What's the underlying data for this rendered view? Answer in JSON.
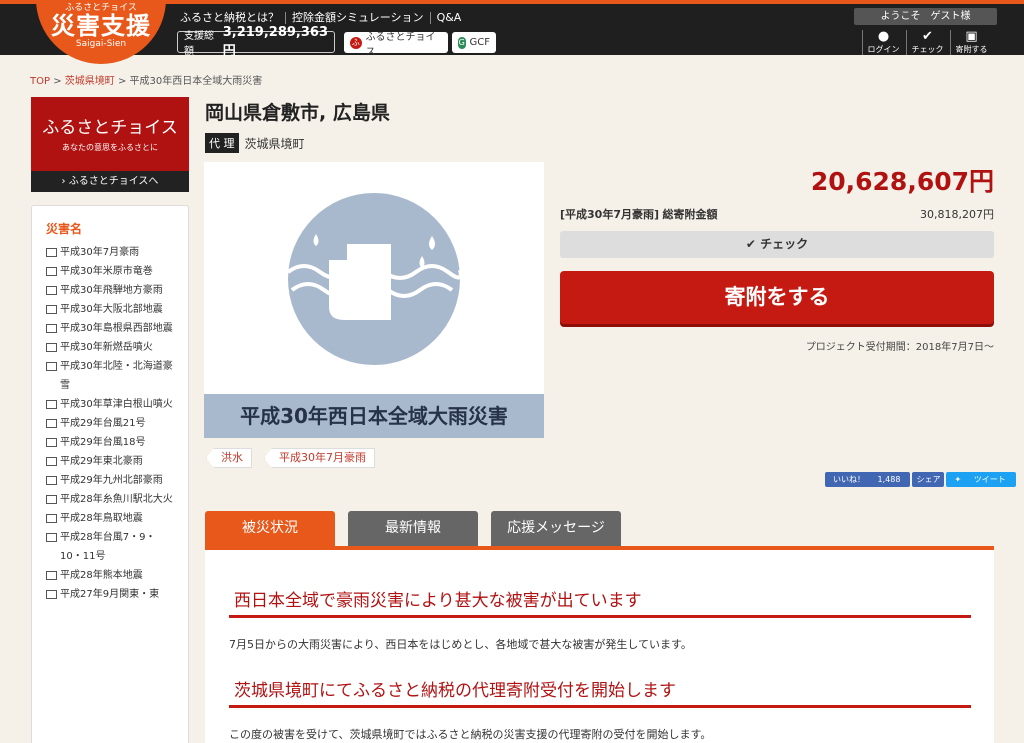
{
  "header": {
    "logo_small": "ふるさとチョイス",
    "logo_big": "災害支援",
    "logo_en": "Saigai-Sien",
    "nav": [
      "ふるさと納税とは？",
      "控除金額シミュレーション",
      "Q&A"
    ],
    "total_label": "支援総額",
    "total_value": "3,219,289,363 円",
    "chip_choice": "ふるさとチョイス",
    "chip_gcf": "GCF",
    "welcome": "ようこそ　ゲスト様",
    "icons": [
      {
        "name": "login",
        "label": "ログイン",
        "glyph": "●"
      },
      {
        "name": "check",
        "label": "チェック",
        "glyph": "✔"
      },
      {
        "name": "donate",
        "label": "寄附する",
        "glyph": "▣"
      }
    ]
  },
  "breadcrumb": {
    "top": "TOP",
    "town": "茨城県境町",
    "current": "平成30年西日本全域大雨災害"
  },
  "banner": {
    "title": "ふるさとチョイス",
    "sub": "あなたの意思をふるさとに",
    "link": "› ふるさとチョイスへ"
  },
  "sidebar": {
    "heading": "災害名",
    "items": [
      "平成30年7月豪雨",
      "平成30年米原市竜巻",
      "平成30年飛騨地方豪雨",
      "平成30年大阪北部地震",
      "平成30年島根県西部地震",
      "平成30年新燃岳噴火",
      "平成30年北陸・北海道豪雪",
      "平成30年草津白根山噴火",
      "平成29年台風21号",
      "平成29年台風18号",
      "平成29年東北豪雨",
      "平成29年九州北部豪雨",
      "平成28年糸魚川駅北大火",
      "平成28年鳥取地震",
      "平成28年台風7・9・10・11号",
      "平成28年熊本地震",
      "平成27年9月関東・東"
    ]
  },
  "main": {
    "title": "岡山県倉敷市, 広島県",
    "proxy_tag": "代 理",
    "proxy_town": "茨城県境町",
    "image_caption": "平成30年西日本全域大雨災害",
    "tags": [
      "洪水",
      "平成30年7月豪雨"
    ],
    "amount": "20,628,607円",
    "total_label_bracket": "[平成30年7月豪雨]",
    "total_label": "総寄附金額",
    "total_value": "30,818,207円",
    "check_label": "✔ チェック",
    "donate_label": "寄附をする",
    "period": "プロジェクト受付期間：2018年7月7日〜",
    "social": {
      "like": "いいね！",
      "like_count": "1,488",
      "share": "シェア",
      "tweet": "ツイート"
    },
    "tabs": [
      "被災状況",
      "最新情報",
      "応援メッセージ"
    ],
    "sections": [
      {
        "heading": "西日本全域で豪雨災害により甚大な被害が出ています",
        "body": "7月5日からの大雨災害により、西日本をはじめとし、各地域で甚大な被害が発生しています。"
      },
      {
        "heading": "茨城県境町にてふるさと納税の代理寄附受付を開始します",
        "body": "この度の被害を受けて、茨城県境町ではふるさと納税の災害支援の代理寄附の受付を開始します。"
      }
    ]
  },
  "colors": {
    "accent": "#e8581a",
    "red": "#c41a12",
    "dark": "#1f1f1f"
  }
}
